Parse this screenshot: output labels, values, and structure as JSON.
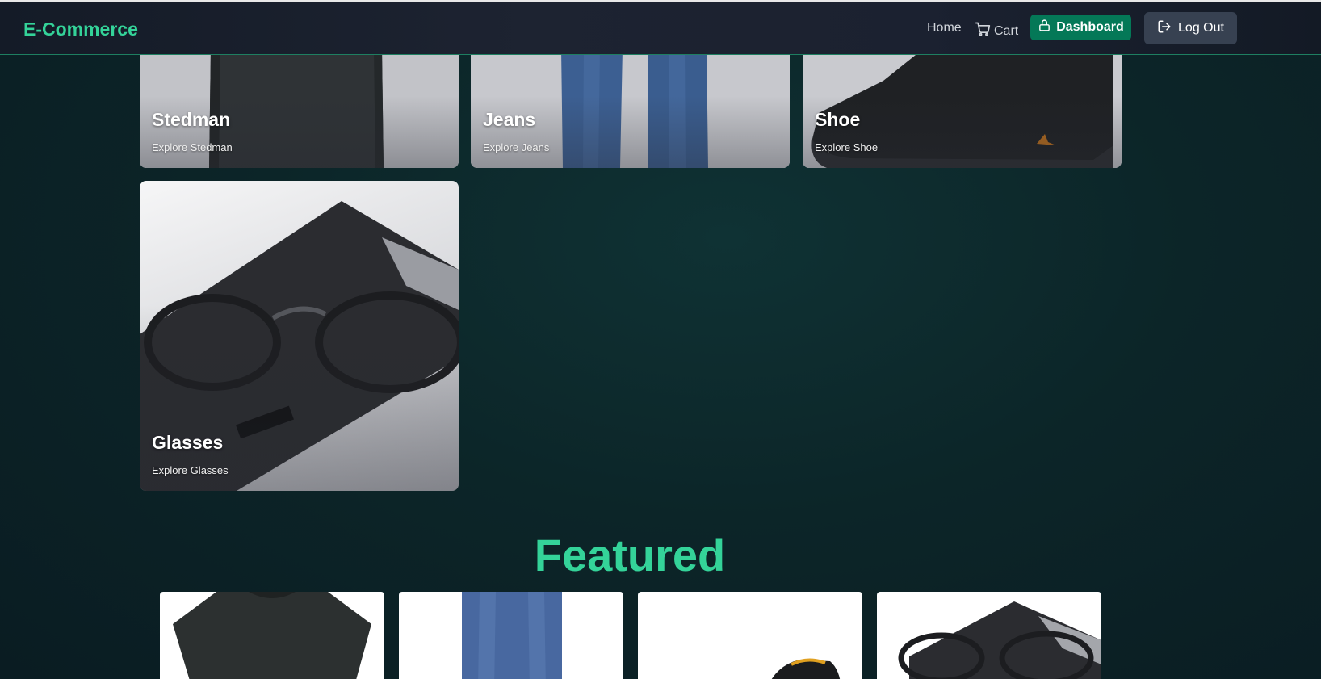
{
  "nav": {
    "brand": "E-Commerce",
    "home": "Home",
    "cart": "Cart",
    "dashboard": "Dashboard",
    "logout": "Log Out"
  },
  "categories": [
    {
      "name": "Stedman",
      "subtitle": "Explore Stedman"
    },
    {
      "name": "Jeans",
      "subtitle": "Explore Jeans"
    },
    {
      "name": "Shoe",
      "subtitle": "Explore Shoe"
    },
    {
      "name": "Glasses",
      "subtitle": "Explore Glasses"
    }
  ],
  "featured": {
    "title": "Featured"
  },
  "colors": {
    "accent": "#34d399",
    "dashboard_button": "#047857",
    "logout_button": "#374151"
  }
}
